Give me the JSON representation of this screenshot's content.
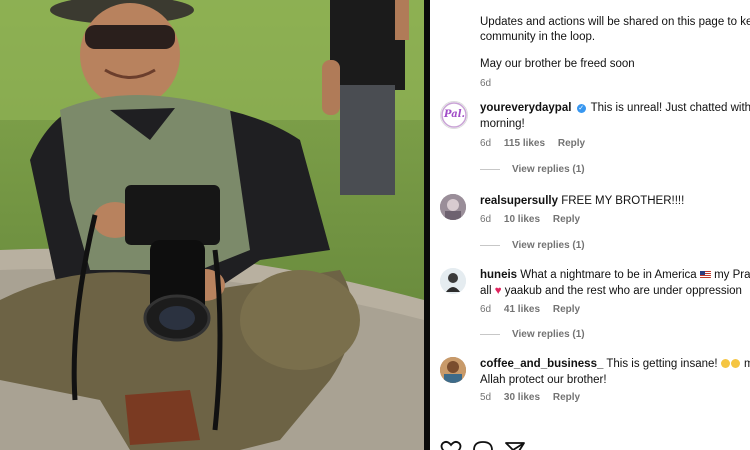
{
  "caption": {
    "line1": "Updates and actions will be shared on this page to keep",
    "line1b": "community in the loop.",
    "line2": "May our brother be freed soon",
    "time": "6d"
  },
  "comments": [
    {
      "username": "youreverydaypal",
      "verified": true,
      "text_a": "This is unreal! Just chatted with him",
      "text_b": "morning!",
      "time": "6d",
      "likes": "115 likes",
      "reply": "Reply",
      "view_replies": "View replies (1)",
      "avatar_text": "Pal.",
      "avatar_color": "#ffffff"
    },
    {
      "username": "realsupersully",
      "text_a": "FREE MY BROTHER!!!!",
      "time": "6d",
      "likes": "10 likes",
      "reply": "Reply",
      "view_replies": "View replies (1)",
      "avatar_color": "#8a7f8c"
    },
    {
      "username": "huneis",
      "text_a": "What a nightmare to be in America",
      "text_a2": "my Prayers",
      "text_b1": "all",
      "text_b2": "yaakub and the rest who are under oppression",
      "time": "6d",
      "likes": "41 likes",
      "reply": "Reply",
      "view_replies": "View replies (1)",
      "avatar_color": "#d9e3ea"
    },
    {
      "username": "coffee_and_business_",
      "text_a": "This is getting insane!",
      "text_a2": "may",
      "text_b": "Allah protect our brother!",
      "time": "5d",
      "likes": "30 likes",
      "reply": "Reply",
      "avatar_color": "#a0704b"
    }
  ],
  "icons": [
    "heart-icon",
    "comment-icon",
    "share-icon"
  ],
  "colors": {
    "verified": "#3897f0",
    "muted": "#737373",
    "heart": "#e0245e"
  }
}
